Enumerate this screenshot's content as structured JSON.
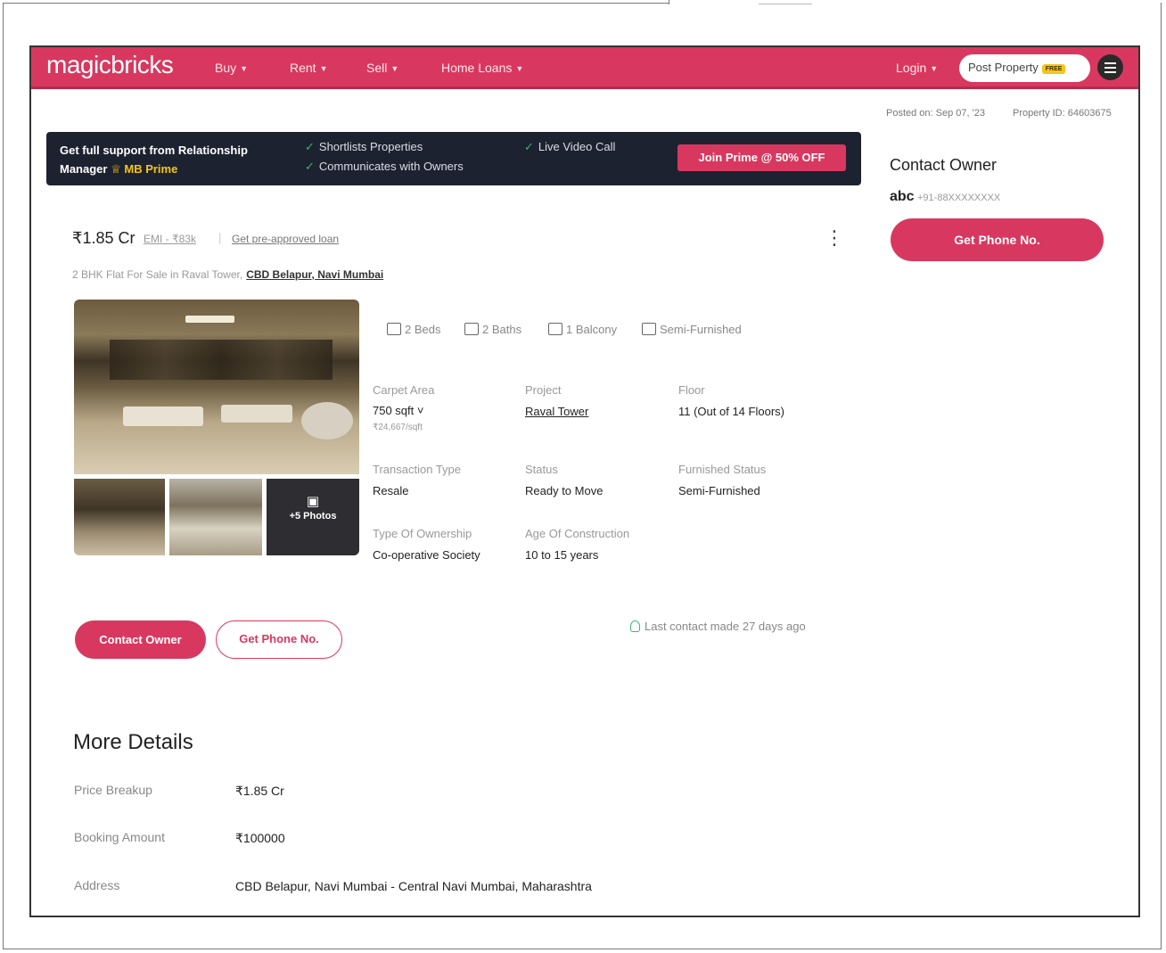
{
  "nav": {
    "logo": "magicbricks",
    "items": [
      {
        "label": "Buy",
        "name": "nav-buy"
      },
      {
        "label": "Rent",
        "name": "nav-rent"
      },
      {
        "label": "Sell",
        "name": "nav-sell"
      },
      {
        "label": "Home Loans",
        "name": "nav-home-loans"
      }
    ],
    "login": "Login",
    "post_property": "Post Property",
    "free_badge": "FREE"
  },
  "meta": {
    "posted_on": "Posted on: Sep 07, '23",
    "property_id": "Property ID: 64603675"
  },
  "prime": {
    "line1": "Get full support from Relationship",
    "line2_prefix": "Manager",
    "line2_brand": "MB Prime",
    "benefits": [
      "Shortlists Properties",
      "Communicates with Owners",
      "Live Video Call"
    ],
    "cta": "Join Prime @ 50% OFF"
  },
  "listing": {
    "price": "₹1.85 Cr",
    "emi": "EMI - ₹83k",
    "preapproved": "Get pre-approved loan",
    "subtitle_prefix": "2 BHK Flat For Sale in Raval Tower,",
    "subtitle_location": "CBD Belapur, Navi Mumbai",
    "more_photos": "+5 Photos",
    "features": {
      "beds": "2 Beds",
      "baths": "2 Baths",
      "balcony": "1 Balcony",
      "furnishing": "Semi-Furnished"
    },
    "details": [
      {
        "label": "Carpet Area",
        "value": "750 sqft ˅",
        "sub": "₹24,667/sqft"
      },
      {
        "label": "Project",
        "value": "Raval Tower"
      },
      {
        "label": "Floor",
        "value": "11 (Out of 14 Floors)"
      },
      {
        "label": "Transaction Type",
        "value": "Resale"
      },
      {
        "label": "Status",
        "value": "Ready to Move"
      },
      {
        "label": "Furnished Status",
        "value": "Semi-Furnished"
      },
      {
        "label": "Type Of Ownership",
        "value": "Co-operative Society"
      },
      {
        "label": "Age Of Construction",
        "value": "10 to 15 years"
      }
    ],
    "contact_owner_btn": "Contact Owner",
    "get_phone_btn": "Get Phone No.",
    "last_contact": "Last contact made 27 days ago"
  },
  "more_details": {
    "title": "More Details",
    "rows": [
      {
        "label": "Price Breakup",
        "value": "₹1.85 Cr"
      },
      {
        "label": "Booking Amount",
        "value": "₹100000"
      },
      {
        "label": "Address",
        "value": "CBD Belapur, Navi Mumbai - Central Navi Mumbai, Maharashtra"
      }
    ]
  },
  "sidebar": {
    "title": "Contact Owner",
    "owner_name": "abc",
    "owner_phone": "+91-88XXXXXXXX",
    "get_phone_btn": "Get Phone No."
  },
  "colors": {
    "brand": "#d8385f",
    "banner_bg": "#1d2230",
    "gold": "#f5c518"
  }
}
